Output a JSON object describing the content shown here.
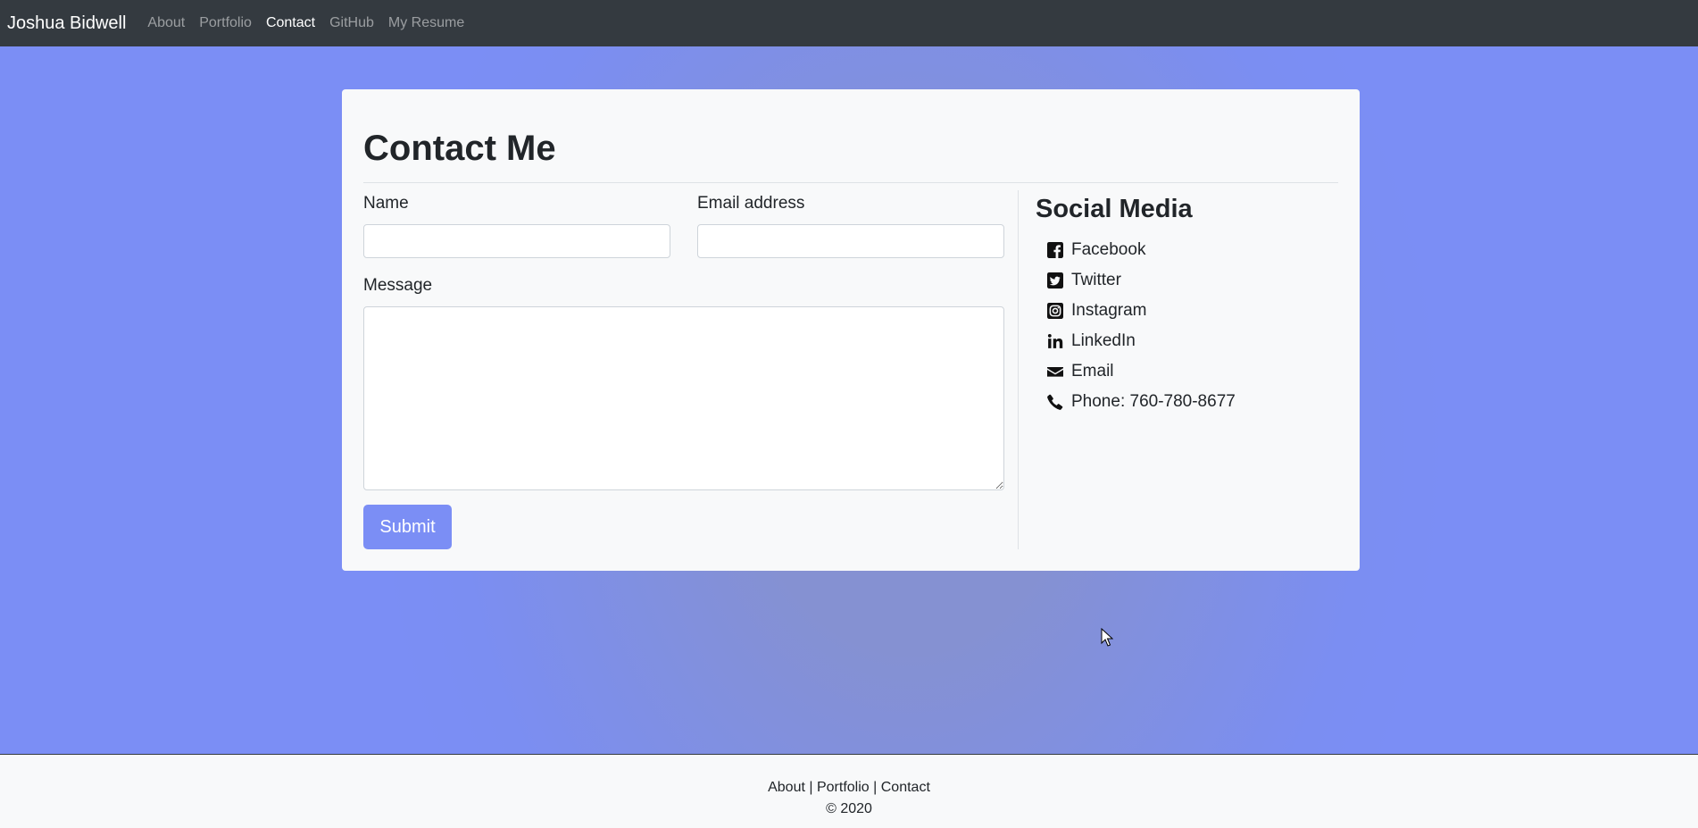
{
  "navbar": {
    "brand": "Joshua Bidwell",
    "links": [
      {
        "label": "About",
        "active": false
      },
      {
        "label": "Portfolio",
        "active": false
      },
      {
        "label": "Contact",
        "active": true
      },
      {
        "label": "GitHub",
        "active": false
      },
      {
        "label": "My Resume",
        "active": false
      }
    ]
  },
  "contact": {
    "title": "Contact Me",
    "name_label": "Name",
    "name_value": "",
    "email_label": "Email address",
    "email_value": "",
    "message_label": "Message",
    "message_value": "",
    "submit_label": "Submit"
  },
  "social": {
    "title": "Social Media",
    "items": [
      {
        "label": "Facebook",
        "icon": "facebook-icon"
      },
      {
        "label": "Twitter",
        "icon": "twitter-icon"
      },
      {
        "label": "Instagram",
        "icon": "instagram-icon"
      },
      {
        "label": "LinkedIn",
        "icon": "linkedin-icon"
      },
      {
        "label": "Email",
        "icon": "envelope-icon"
      },
      {
        "label": "Phone: 760-780-8677",
        "icon": "phone-icon"
      }
    ]
  },
  "footer": {
    "links": [
      {
        "label": "About"
      },
      {
        "label": "Portfolio"
      },
      {
        "label": "Contact"
      }
    ],
    "separator": "|",
    "copyright": "© 2020"
  },
  "colors": {
    "navbar": "#343a40",
    "accent": "#7b8ef5",
    "card": "#f8f9fa",
    "background": "#7b8ef5"
  }
}
